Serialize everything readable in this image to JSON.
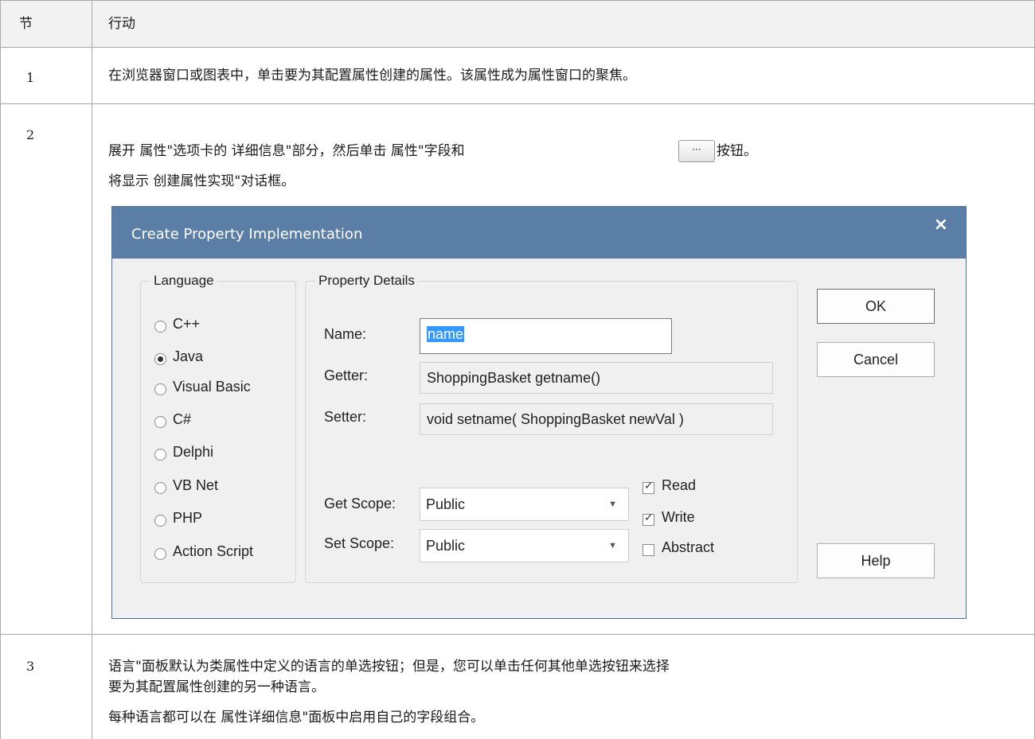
{
  "table": {
    "col_step": "节",
    "col_action": "行动",
    "rows": [
      {
        "step": "1",
        "lines": [
          "在浏览器窗口或图表中，单击要为其配置属性创建的属性。该属性成为属性窗口的聚焦。"
        ]
      },
      {
        "step": "2",
        "line1_before": "展开 属性\"选项卡的 详细信息\"部分，然后单击 属性\"字段和",
        "line1_button": "···",
        "line1_after": "按钮。",
        "line2": "将显示 创建属性实现\"对话框。"
      },
      {
        "step": "3",
        "lines": [
          " 语言\"面板默认为类属性中定义的语言的单选按钮；但是，您可以单击任何其他单选按钮来选择",
          "要为其配置属性创建的另一种语言。",
          "每种语言都可以在 属性详细信息\"面板中启用自己的字段组合。"
        ]
      }
    ]
  },
  "dialog": {
    "title": "Create Property Implementation",
    "close_glyph": "×",
    "language_group": {
      "label": "Language",
      "options": [
        "C++",
        "Java",
        "Visual Basic",
        "C#",
        "Delphi",
        "VB Net",
        "PHP",
        "Action Script"
      ],
      "selected": "Java"
    },
    "details_group": {
      "label": "Property Details",
      "name_label": "Name:",
      "name_value": "name",
      "getter_label": "Getter:",
      "getter_value": "ShoppingBasket getname()",
      "setter_label": "Setter:",
      "setter_value": "void setname( ShoppingBasket newVal )",
      "get_scope_label": "Get Scope:",
      "get_scope_value": "Public",
      "set_scope_label": "Set Scope:",
      "set_scope_value": "Public",
      "combo_arrow": "▼",
      "checkboxes": [
        {
          "label": "Read",
          "checked": true
        },
        {
          "label": "Write",
          "checked": true
        },
        {
          "label": "Abstract",
          "checked": false
        }
      ]
    },
    "buttons": {
      "ok": "OK",
      "cancel": "Cancel",
      "help": "Help"
    }
  }
}
